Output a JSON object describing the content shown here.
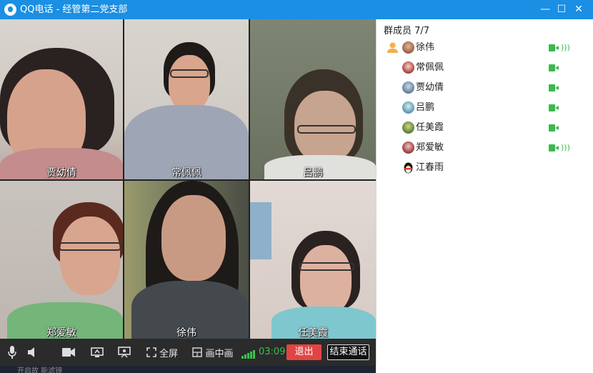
{
  "window": {
    "title": "QQ电话 - 经管第二党支部",
    "minimize_glyph": "—",
    "maximize_glyph": "☐",
    "close_glyph": "✕"
  },
  "videos": [
    {
      "name": "贾幼倩"
    },
    {
      "name": "常佩佩"
    },
    {
      "name": "吕鹏"
    },
    {
      "name": "郑爱敏"
    },
    {
      "name": "徐伟"
    },
    {
      "name": "任美霞"
    }
  ],
  "controls": {
    "mic_icon": "microphone-icon",
    "speaker_icon": "speaker-icon",
    "camera_icon": "camera-icon",
    "screenshare_icon": "screen-share-icon",
    "presentation_icon": "presentation-icon",
    "fullscreen_label": "全屏",
    "pip_label": "画中画",
    "timer": "03:09",
    "exit_label": "退出",
    "end_call_label": "结束通话"
  },
  "taskbar": {
    "faint_text": "开启故 能滤镜"
  },
  "members_panel": {
    "header": "群成员 7/7",
    "members": [
      {
        "name": "徐伟",
        "video": true,
        "speaking": true,
        "host": true
      },
      {
        "name": "常佩佩",
        "video": true,
        "speaking": false
      },
      {
        "name": "贾幼倩",
        "video": true,
        "speaking": false
      },
      {
        "name": "吕鹏",
        "video": true,
        "speaking": false
      },
      {
        "name": "任美霞",
        "video": true,
        "speaking": false
      },
      {
        "name": "郑爱敏",
        "video": true,
        "speaking": true
      },
      {
        "name": "江春雨",
        "video": false,
        "speaking": false
      }
    ]
  },
  "colors": {
    "titlebar": "#1a8fe3",
    "exit_button": "#e24444",
    "active_green": "#3aba4d"
  }
}
